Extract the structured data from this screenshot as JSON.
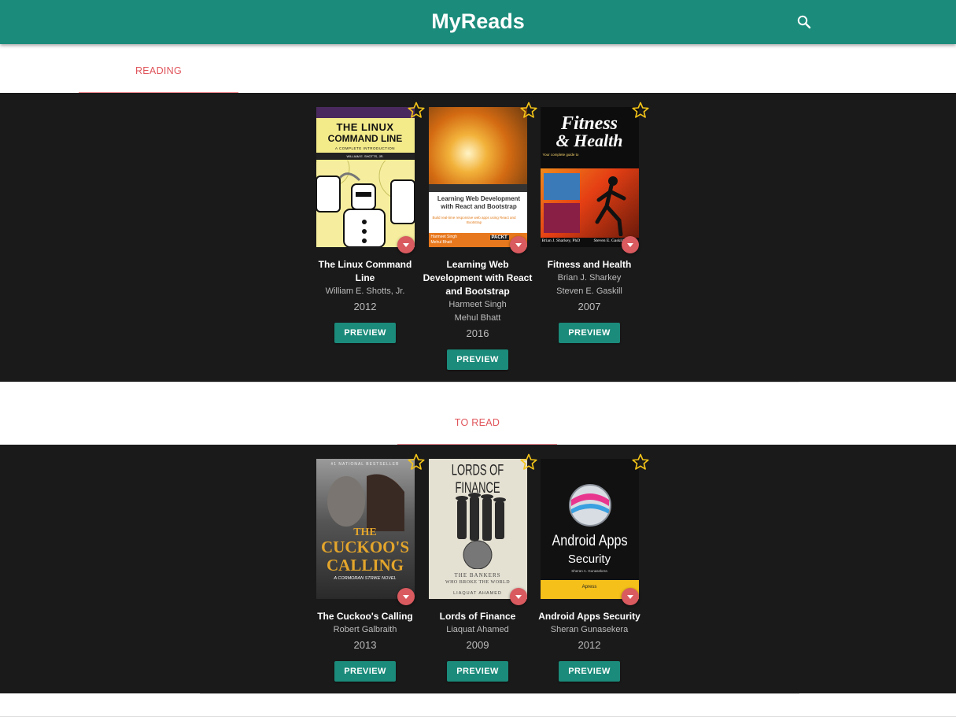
{
  "app": {
    "title": "MyReads",
    "search_icon": "search-icon",
    "accent": "#1b8b7b",
    "tab_color": "#e0555b"
  },
  "shelves": [
    {
      "label": "READING",
      "books": [
        {
          "title": "The Linux Command Line",
          "authors": [
            "William E. Shotts, Jr."
          ],
          "year": "2012",
          "preview": "PREVIEW",
          "cover_text": [
            "THE LINUX",
            "COMMAND LINE",
            "A COMPLETE INTRODUCTION",
            "WILLIAM E. SHOTTS, JR."
          ]
        },
        {
          "title": "Learning Web Development with React and Bootstrap",
          "authors": [
            "Harmeet Singh",
            "Mehul Bhatt"
          ],
          "year": "2016",
          "preview": "PREVIEW",
          "cover_text": [
            "Learning Web Development",
            "with React and Bootstrap",
            "Build real-time responsive web apps using React and Bootstrap",
            "Harmeet Singh",
            "Mehul Bhatt",
            "PACKT"
          ]
        },
        {
          "title": "Fitness and Health",
          "authors": [
            "Brian J. Sharkey",
            "Steven E. Gaskill"
          ],
          "year": "2007",
          "preview": "PREVIEW",
          "cover_text": [
            "Fitness",
            "& Health",
            "Your complete guide to",
            "Brian J. Sharkey, PhD",
            "Steven E. Gaskill"
          ]
        }
      ]
    },
    {
      "label": "TO READ",
      "books": [
        {
          "title": "The Cuckoo's Calling",
          "authors": [
            "Robert Galbraith"
          ],
          "year": "2013",
          "preview": "PREVIEW",
          "cover_text": [
            "#1 NATIONAL BESTSELLER",
            "THE",
            "CUCKOO'S",
            "CALLING",
            "A CORMORAN STRIKE NOVEL"
          ]
        },
        {
          "title": "Lords of Finance",
          "authors": [
            "Liaquat Ahamed"
          ],
          "year": "2009",
          "preview": "PREVIEW",
          "cover_text": [
            "LORDS OF FINANCE",
            "THE BANKERS",
            "WHO BROKE THE WORLD",
            "LIAQUAT AHAMED"
          ]
        },
        {
          "title": "Android Apps Security",
          "authors": [
            "Sheran Gunasekera"
          ],
          "year": "2012",
          "preview": "PREVIEW",
          "cover_text": [
            "Android Apps",
            "Security",
            "Sheran A. Gunasekera",
            "Apress"
          ]
        }
      ]
    }
  ]
}
